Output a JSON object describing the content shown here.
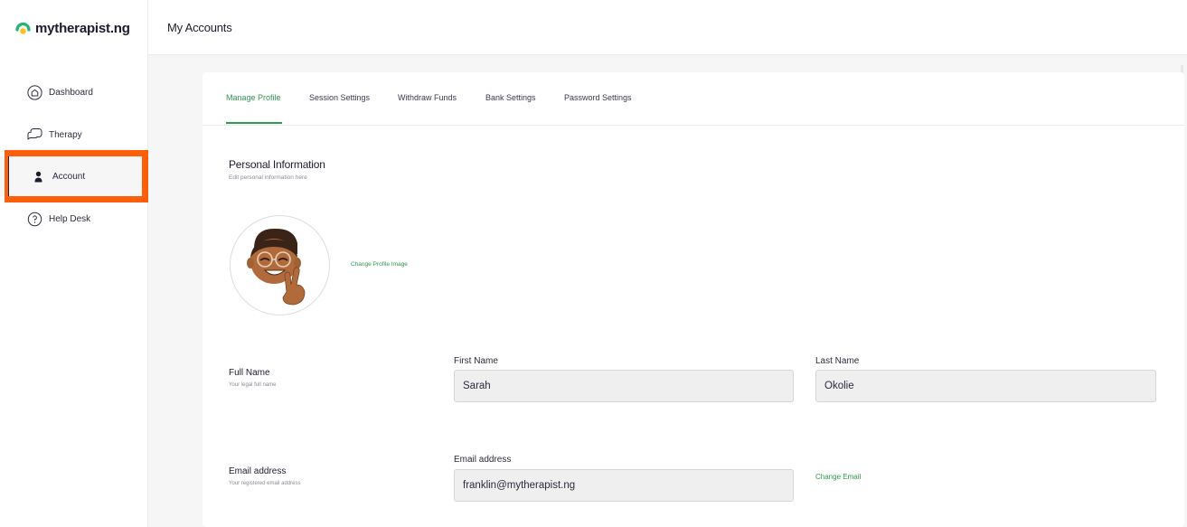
{
  "brand": {
    "name": "mytherapist.ng"
  },
  "topbar": {
    "title": "My Accounts"
  },
  "sidebar": {
    "items": [
      {
        "label": "Dashboard",
        "icon": "home-icon"
      },
      {
        "label": "Therapy",
        "icon": "chat-icon"
      },
      {
        "label": "Account",
        "icon": "user-icon",
        "active": true
      },
      {
        "label": "Help Desk",
        "icon": "help-icon"
      }
    ]
  },
  "tabs": [
    {
      "label": "Manage Profile",
      "active": true
    },
    {
      "label": "Session Settings"
    },
    {
      "label": "Withdraw Funds"
    },
    {
      "label": "Bank Settings"
    },
    {
      "label": "Password Settings"
    }
  ],
  "personal": {
    "title": "Personal Information",
    "subtitle": "Edit personal information here",
    "change_image": "Change Profile Image"
  },
  "full_name": {
    "label": "Full Name",
    "sub": "Your legal full name",
    "first_label": "First Name",
    "first_value": "Sarah",
    "last_label": "Last Name",
    "last_value": "Okolie"
  },
  "email": {
    "label": "Email address",
    "sub": "Your registered email address",
    "field_label": "Email address",
    "value": "franklin@mytherapist.ng",
    "change": "Change Email"
  },
  "colors": {
    "accent": "#2e9a4f",
    "highlight": "#fb5f0b",
    "logo_green": "#22b573",
    "logo_yellow": "#f5c518"
  }
}
